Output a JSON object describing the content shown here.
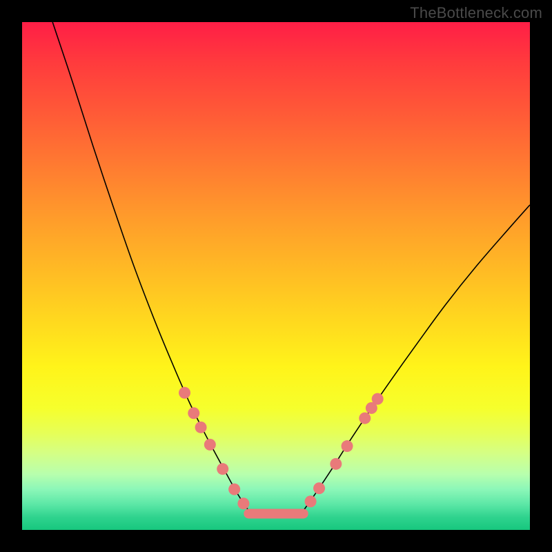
{
  "watermark": "TheBottleneck.com",
  "colors": {
    "marker": "#e97a7a",
    "line": "#000000"
  },
  "chart_data": {
    "type": "line",
    "title": "",
    "xlabel": "",
    "ylabel": "",
    "xlim": [
      0,
      100
    ],
    "ylim": [
      0,
      100
    ],
    "grid": false,
    "series": [
      {
        "name": "left-curve",
        "x": [
          6,
          10,
          14,
          18,
          22,
          26,
          29.5,
          33,
          36.5,
          40,
          42.5,
          44.6
        ],
        "y": [
          100,
          88,
          75.5,
          63.5,
          52,
          41.5,
          33,
          25,
          18,
          11.5,
          7,
          3.8
        ]
      },
      {
        "name": "right-curve",
        "x": [
          55.4,
          58,
          61,
          64.5,
          68.5,
          73,
          78,
          83.5,
          89.5,
          96,
          100
        ],
        "y": [
          3.8,
          7.5,
          12,
          17.5,
          23.5,
          30,
          37,
          44.5,
          52,
          59.5,
          64
        ]
      },
      {
        "name": "plateau",
        "x": [
          44.6,
          55.4
        ],
        "y": [
          3.2,
          3.2
        ]
      }
    ],
    "markers": [
      {
        "series": "left-curve",
        "x": 32.0,
        "y": 27.0
      },
      {
        "series": "left-curve",
        "x": 33.8,
        "y": 23.0
      },
      {
        "series": "left-curve",
        "x": 35.2,
        "y": 20.2
      },
      {
        "series": "left-curve",
        "x": 37.0,
        "y": 16.8
      },
      {
        "series": "left-curve",
        "x": 39.5,
        "y": 12.0
      },
      {
        "series": "left-curve",
        "x": 41.8,
        "y": 8.0
      },
      {
        "series": "left-curve",
        "x": 43.6,
        "y": 5.2
      },
      {
        "series": "right-curve",
        "x": 56.8,
        "y": 5.6
      },
      {
        "series": "right-curve",
        "x": 58.5,
        "y": 8.2
      },
      {
        "series": "right-curve",
        "x": 61.8,
        "y": 13.0
      },
      {
        "series": "right-curve",
        "x": 64.0,
        "y": 16.5
      },
      {
        "series": "right-curve",
        "x": 67.5,
        "y": 22.0
      },
      {
        "series": "right-curve",
        "x": 68.8,
        "y": 24.0
      },
      {
        "series": "right-curve",
        "x": 70.0,
        "y": 25.8
      }
    ]
  }
}
